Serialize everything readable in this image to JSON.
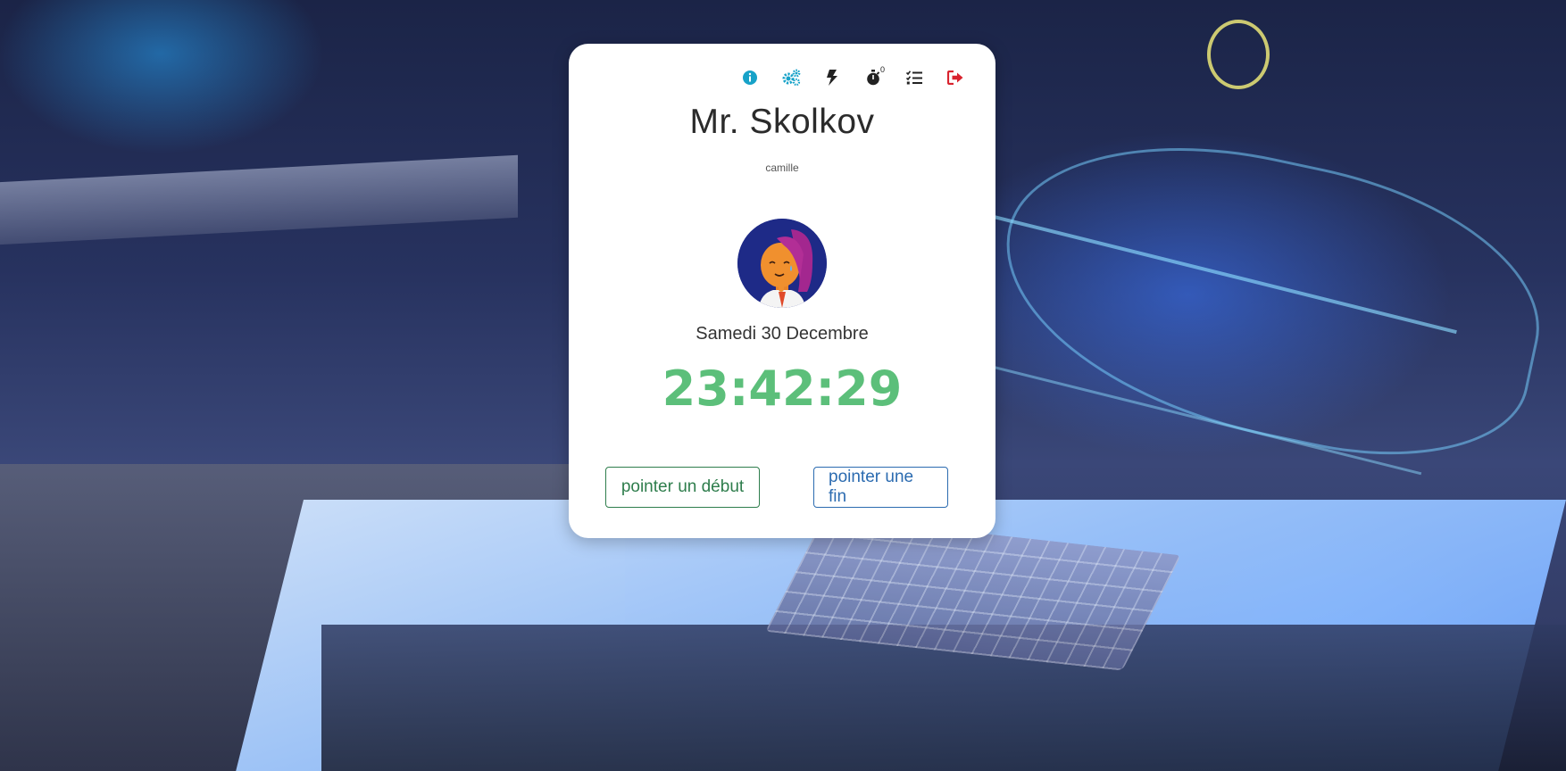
{
  "header": {
    "tools": [
      {
        "name": "info-icon",
        "color": "#17a2c8"
      },
      {
        "name": "gears-icon",
        "color": "#17a2c8"
      },
      {
        "name": "bolt-icon",
        "color": "#222222"
      },
      {
        "name": "stopwatch-icon",
        "color": "#222222",
        "badge": "0"
      },
      {
        "name": "tasks-icon",
        "color": "#222222"
      },
      {
        "name": "sign-out-icon",
        "color": "#d9232e"
      }
    ]
  },
  "profile": {
    "name": "Mr. Skolkov",
    "username": "camille",
    "avatar": "woman-avatar"
  },
  "date_label": "Samedi 30 Decembre",
  "clock": "23:42:29",
  "actions": {
    "start_label": "pointer un début",
    "end_label": "pointer une fin"
  },
  "colors": {
    "clock": "#5cbf7a",
    "start_button": "#2e7d4c",
    "end_button": "#2b6bb0",
    "logout": "#d9232e",
    "info": "#17a2c8"
  }
}
